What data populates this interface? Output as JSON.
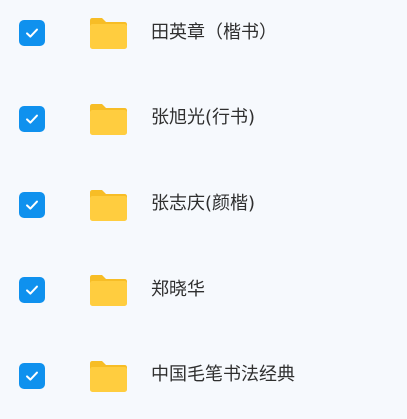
{
  "file_list": {
    "items": [
      {
        "name": "田英章（楷书）",
        "selected": true,
        "icon": "folder-icon"
      },
      {
        "name": "张旭光(行书)",
        "selected": true,
        "icon": "folder-icon"
      },
      {
        "name": "张志庆(颜楷)",
        "selected": true,
        "icon": "folder-icon"
      },
      {
        "name": "郑晓华",
        "selected": true,
        "icon": "folder-icon"
      },
      {
        "name": "中国毛笔书法经典",
        "selected": true,
        "icon": "folder-icon"
      }
    ]
  },
  "colors": {
    "background": "#f6f9fd",
    "checkbox": "#0f91ee",
    "folder": "#ffcd3f",
    "folder_tab": "#f7bd26",
    "text": "#2f2f2f"
  }
}
